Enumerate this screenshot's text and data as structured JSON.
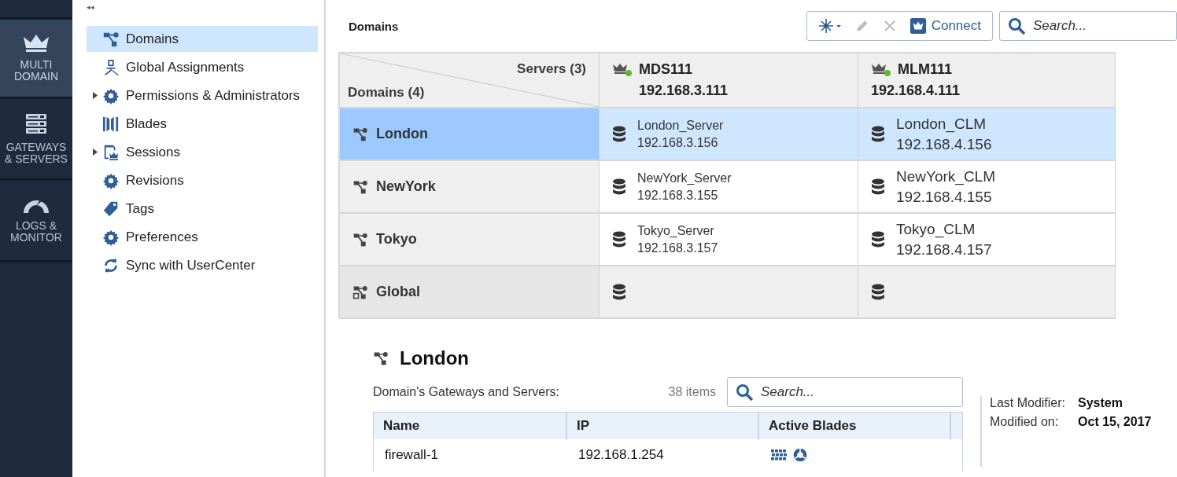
{
  "nav_rail": {
    "collapse_glyph": "◂◂",
    "items": [
      {
        "label": "MULTI DOMAIN",
        "kind": "crown",
        "selected": true
      },
      {
        "label": "GATEWAYS & SERVERS",
        "kind": "servers",
        "selected": false
      },
      {
        "label": "LOGS & MONITOR",
        "kind": "gauge",
        "selected": false
      }
    ]
  },
  "tree": {
    "items": [
      {
        "label": "Domains",
        "kind": "domain",
        "selected": true
      },
      {
        "label": "Global Assignments",
        "kind": "global",
        "selected": false
      },
      {
        "label": "Permissions & Administrators",
        "kind": "gear",
        "selected": false,
        "expanded": false
      },
      {
        "label": "Blades",
        "kind": "blades",
        "selected": false
      },
      {
        "label": "Sessions",
        "kind": "session",
        "selected": false,
        "expanded": false
      },
      {
        "label": "Revisions",
        "kind": "gear",
        "selected": false
      },
      {
        "label": "Tags",
        "kind": "tag",
        "selected": false
      },
      {
        "label": "Preferences",
        "kind": "gear",
        "selected": false
      },
      {
        "label": "Sync with UserCenter",
        "kind": "sync",
        "selected": false
      }
    ]
  },
  "page_title": "Domains",
  "toolbar": {
    "buttons": [
      {
        "kind": "new",
        "disabled": false
      },
      {
        "kind": "edit",
        "disabled": true
      },
      {
        "kind": "delete",
        "disabled": true
      },
      {
        "kind": "connect",
        "label": "Connect",
        "disabled": false
      }
    ],
    "search": {
      "placeholder": "Search..."
    }
  },
  "matrix": {
    "servers_label": "Servers (3)",
    "domains_label": "Domains (4)",
    "servers": [
      {
        "name": "MDS111",
        "ip": "192.168.3.111",
        "color": "#5cb82e"
      },
      {
        "name": "MLM111",
        "ip": "192.168.4.111",
        "color": "#5cb82e"
      }
    ],
    "rows": [
      {
        "name": "London",
        "kind": "domain",
        "selected": true,
        "cells": [
          {
            "name": "London_Server",
            "ip": "192.168.3.156"
          },
          {
            "name": "London_CLM",
            "ip": "192.168.4.156"
          }
        ]
      },
      {
        "name": "NewYork",
        "kind": "domain",
        "selected": false,
        "cells": [
          {
            "name": "NewYork_Server",
            "ip": "192.168.3.155"
          },
          {
            "name": "NewYork_CLM",
            "ip": "192.168.4.155"
          }
        ]
      },
      {
        "name": "Tokyo",
        "kind": "domain",
        "selected": false,
        "cells": [
          {
            "name": "Tokyo_Server",
            "ip": "192.168.3.157"
          },
          {
            "name": "Tokyo_CLM",
            "ip": "192.168.4.157"
          }
        ]
      },
      {
        "name": "Global",
        "kind": "global",
        "selected": false,
        "cells": [
          {},
          {}
        ]
      }
    ]
  },
  "details": {
    "title": "London",
    "list_label": "Domain's Gateways and Servers:",
    "count": "38 items",
    "search": {
      "placeholder": "Search..."
    },
    "columns": [
      "Name",
      "IP",
      "Active Blades"
    ],
    "rows": [
      {
        "name": "firewall-1",
        "ip": "192.168.1.254"
      }
    ],
    "meta": [
      {
        "label": "Last Modifier:",
        "value": "System"
      },
      {
        "label": "Modified on:",
        "value": "Oct 15, 2017"
      }
    ]
  }
}
